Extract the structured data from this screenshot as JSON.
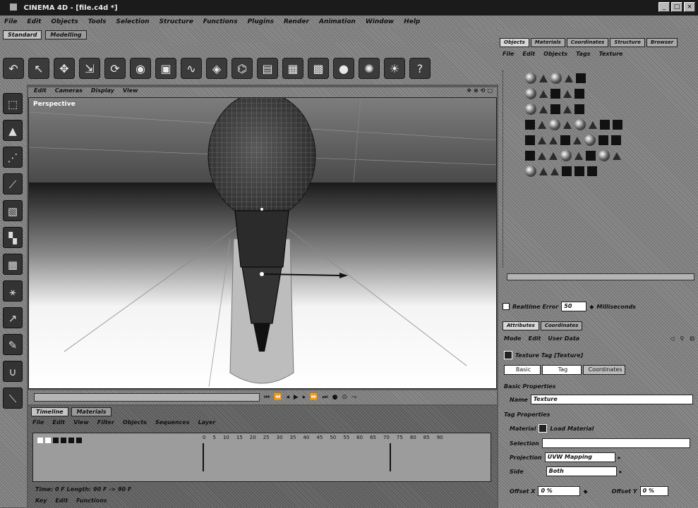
{
  "window": {
    "title": "CINEMA 4D - [file.c4d *]"
  },
  "menu": [
    "File",
    "Edit",
    "Objects",
    "Tools",
    "Selection",
    "Structure",
    "Functions",
    "Plugins",
    "Render",
    "Animation",
    "Window",
    "Help"
  ],
  "layout_tabs": [
    "Standard",
    "Modelling"
  ],
  "toolbar": {
    "icons": [
      "undo-icon",
      "pointer-icon",
      "move-icon",
      "scale-icon",
      "rotate-icon",
      "camera-icon",
      "cube-icon",
      "spline-icon",
      "nurbs-icon",
      "deformer-icon",
      "scene-icon",
      "render-icon",
      "render-view-icon",
      "material-icon",
      "light-icon",
      "bulb-icon",
      "help-icon"
    ]
  },
  "viewport": {
    "menu": [
      "Edit",
      "Cameras",
      "Display",
      "View"
    ],
    "label": "Perspective",
    "nav_icons": [
      "move-view-icon",
      "zoom-view-icon",
      "rotate-view-icon",
      "maximize-view-icon"
    ]
  },
  "timeline": {
    "tabs": [
      "Timeline",
      "Materials"
    ],
    "menu": [
      "File",
      "Edit",
      "View",
      "Filter",
      "Objects",
      "Sequences",
      "Layer"
    ],
    "ticks": [
      "0",
      "5",
      "10",
      "15",
      "20",
      "25",
      "30",
      "35",
      "40",
      "45",
      "50",
      "55",
      "60",
      "65",
      "70",
      "75",
      "80",
      "85",
      "90"
    ],
    "status": "Time: 0 F   Length: 90 F   -> 90 F",
    "bottom": [
      "Key",
      "Edit",
      "Functions"
    ]
  },
  "object_manager": {
    "tabs": [
      "Objects",
      "Materials",
      "Coordinates",
      "Structure",
      "Browser"
    ],
    "menu": [
      "File",
      "Edit",
      "Objects",
      "Tags",
      "Texture"
    ],
    "rows": 7
  },
  "render_bar": {
    "label": "Realtime Error",
    "value": "50",
    "unit": "Milliseconds"
  },
  "attributes": {
    "tabs": [
      "Attributes",
      "Coordinates"
    ],
    "menu": [
      "Mode",
      "Edit",
      "User Data"
    ],
    "object_name": "Texture Tag [Texture]",
    "sub_tabs": [
      "Basic",
      "Tag",
      "Coordinates"
    ],
    "basic_header": "Basic Properties",
    "name_label": "Name",
    "name_value": "Texture",
    "tag_header": "Tag Properties",
    "material_label": "Material",
    "material_value": "Load Material",
    "selection_label": "Selection",
    "selection_value": "",
    "projection_label": "Projection",
    "projection_value": "UVW Mapping",
    "side_label": "Side",
    "side_value": "Both",
    "offset_x_label": "Offset X",
    "offset_x_value": "0 %",
    "offset_y_label": "Offset Y",
    "offset_y_value": "0 %"
  },
  "transport": [
    "first-frame-icon",
    "prev-key-icon",
    "prev-frame-icon",
    "play-icon",
    "next-frame-icon",
    "next-key-icon",
    "last-frame-icon",
    "record-icon",
    "auto-key-icon",
    "motion-icon"
  ]
}
